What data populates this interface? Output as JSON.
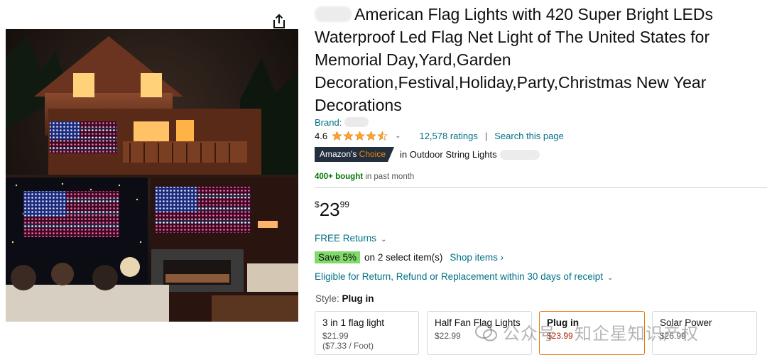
{
  "product": {
    "title": "American Flag Lights with 420 Super Bright LEDs Waterproof Led Flag Net Light of The United States for Memorial Day,Yard,Garden Decoration,Festival,Holiday,Party,Christmas New Year Decorations",
    "brand_label": "Brand:",
    "rating": "4.6",
    "rating_stars": 4.5,
    "ratings_count": "12,578 ratings",
    "search_page": "Search this page",
    "separator": "|",
    "choice_badge_prefix": "Amazon's",
    "choice_badge_word": "Choice",
    "choice_category": "in Outdoor String Lights",
    "bought_bold": "400+ bought",
    "bought_rest": "in past month",
    "price_symbol": "$",
    "price_whole": "23",
    "price_fraction": "99",
    "free_returns": "FREE Returns",
    "save_badge": "Save 5%",
    "save_text": "on 2 select item(s)",
    "shop_items": "Shop items ›",
    "eligible": "Eligible for Return, Refund or Replacement within 30 days of receipt",
    "style_label": "Style:",
    "style_value": "Plug in",
    "options": [
      {
        "name": "3 in 1 flag light",
        "price": "$21.99",
        "unit": "($7.33 / Foot)"
      },
      {
        "name": "Half Fan Flag Lights",
        "price": "$22.99",
        "unit": ""
      },
      {
        "name": "Plug in",
        "price": "$23.99",
        "unit": ""
      },
      {
        "name": "Solar Power",
        "price": "$26.99",
        "unit": ""
      }
    ]
  },
  "watermark": "公众号 · 知企星知识产权",
  "colors": {
    "link": "#007185",
    "badge_dark": "#232f3e",
    "badge_orange": "#f08804",
    "save_green": "#7fda69",
    "selected_border": "#e47911",
    "price_red": "#b12704",
    "star": "#ffa41c"
  },
  "icons": {
    "share": "share-icon",
    "stars": "star-icon",
    "caret": "chevron-down-icon"
  }
}
